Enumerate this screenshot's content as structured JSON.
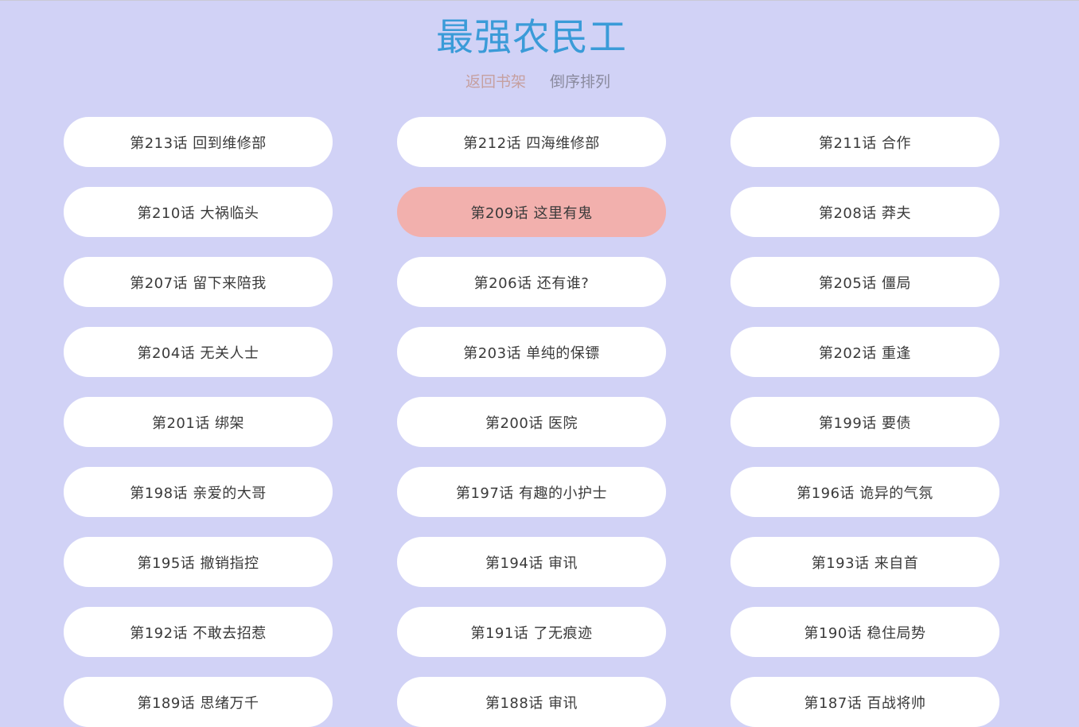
{
  "header": {
    "title": "最强农民工",
    "back_label": "返回书架",
    "sort_label": "倒序排列"
  },
  "colors": {
    "background": "#d1d2f6",
    "title": "#3a9bd8",
    "chapter_bg": "#ffffff",
    "current_chapter_bg": "#f2b0ad"
  },
  "current_chapter": "第209话 这里有鬼",
  "chapters": [
    "第213话 回到维修部",
    "第212话 四海维修部",
    "第211话 合作",
    "第210话 大祸临头",
    "第209话 这里有鬼",
    "第208话 莽夫",
    "第207话 留下来陪我",
    "第206话 还有谁?",
    "第205话 僵局",
    "第204话 无关人士",
    "第203话 单纯的保镖",
    "第202话 重逢",
    "第201话 绑架",
    "第200话 医院",
    "第199话 要债",
    "第198话 亲爱的大哥",
    "第197话 有趣的小护士",
    "第196话 诡异的气氛",
    "第195话 撤销指控",
    "第194话 审讯",
    "第193话 来自首",
    "第192话 不敢去招惹",
    "第191话 了无痕迹",
    "第190话 稳住局势",
    "第189话 思绪万千",
    "第188话 审讯",
    "第187话 百战将帅"
  ]
}
